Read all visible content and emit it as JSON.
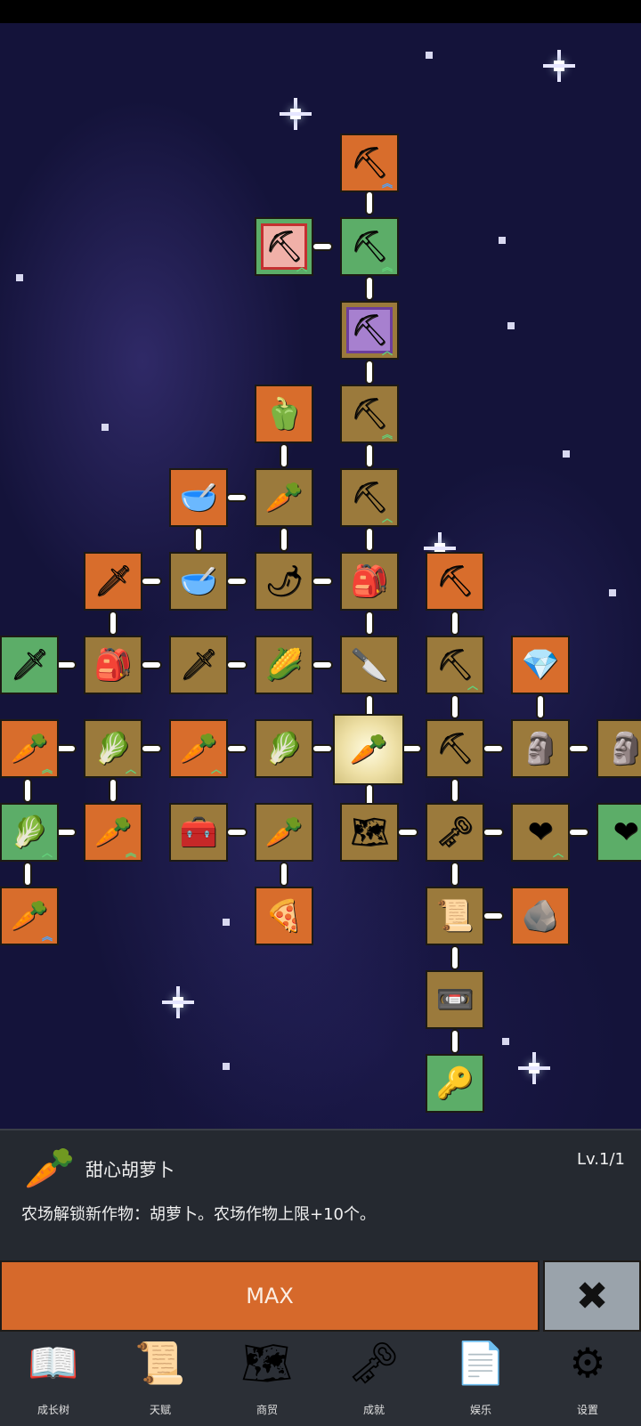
{
  "skill_tree": {
    "nodes": [
      {
        "id": "shovel-top",
        "icon": "shovel-icon",
        "glyph": "⛏",
        "color": "orange",
        "up": "︽",
        "up_color": "blue"
      },
      {
        "id": "shovel-red",
        "icon": "shovel-icon",
        "glyph": "⛏",
        "color": "green",
        "frame": "red",
        "up": "︿"
      },
      {
        "id": "shovel-2",
        "icon": "shovel-icon",
        "glyph": "⛏",
        "color": "green",
        "up": "︽"
      },
      {
        "id": "shovel-purple",
        "icon": "shovel-icon",
        "glyph": "⛏",
        "color": "tan",
        "frame": "purple",
        "up": "︿"
      },
      {
        "id": "pepper",
        "icon": "bell-pepper-icon",
        "glyph": "🫑",
        "color": "orange"
      },
      {
        "id": "shovel-3",
        "icon": "shovel-icon",
        "glyph": "⛏",
        "color": "tan",
        "up": "︽"
      },
      {
        "id": "bowl-1",
        "icon": "bowl-icon",
        "glyph": "🥣",
        "color": "orange"
      },
      {
        "id": "radish",
        "icon": "radish-icon",
        "glyph": "🥕",
        "color": "tan"
      },
      {
        "id": "shovel-4",
        "icon": "shovel-icon",
        "glyph": "⛏",
        "color": "tan",
        "up": "︿"
      },
      {
        "id": "sword-gold",
        "icon": "sword-icon",
        "glyph": "🗡",
        "color": "orange"
      },
      {
        "id": "bowl-2",
        "icon": "bowl-icon",
        "glyph": "🥣",
        "color": "tan"
      },
      {
        "id": "chili",
        "icon": "chili-icon",
        "glyph": "🌶",
        "color": "tan"
      },
      {
        "id": "backpack-1",
        "icon": "backpack-icon",
        "glyph": "🎒",
        "color": "tan"
      },
      {
        "id": "pickaxe-1",
        "icon": "pickaxe-icon",
        "glyph": "⛏",
        "color": "orange"
      },
      {
        "id": "sword-green",
        "icon": "sword-icon",
        "glyph": "🗡",
        "color": "green"
      },
      {
        "id": "backpack-2",
        "icon": "backpack-icon",
        "glyph": "🎒",
        "color": "tan"
      },
      {
        "id": "sword-2",
        "icon": "sword-icon",
        "glyph": "🗡",
        "color": "tan"
      },
      {
        "id": "corn",
        "icon": "corn-icon",
        "glyph": "🌽",
        "color": "tan"
      },
      {
        "id": "dagger",
        "icon": "dagger-icon",
        "glyph": "🔪",
        "color": "tan"
      },
      {
        "id": "pickaxe-2",
        "icon": "pickaxe-icon",
        "glyph": "⛏",
        "color": "tan",
        "up": "︿"
      },
      {
        "id": "crystal",
        "icon": "crystal-icon",
        "glyph": "💎",
        "color": "orange"
      },
      {
        "id": "carrot-1",
        "icon": "carrot-icon",
        "glyph": "🥕",
        "color": "orange",
        "up": "︽"
      },
      {
        "id": "cabbage-1",
        "icon": "cabbage-icon",
        "glyph": "🥬",
        "color": "tan",
        "up": "︿"
      },
      {
        "id": "carrot-2",
        "icon": "carrot-icon",
        "glyph": "🥕",
        "color": "orange",
        "up": "︿"
      },
      {
        "id": "cabbage-2",
        "icon": "cabbage-icon",
        "glyph": "🥬",
        "color": "tan"
      },
      {
        "id": "carrot-center",
        "icon": "carrot-icon",
        "glyph": "🥕",
        "color": "center"
      },
      {
        "id": "pickaxe-3",
        "icon": "pickaxe-icon",
        "glyph": "⛏",
        "color": "tan"
      },
      {
        "id": "statue-1",
        "icon": "statue-icon",
        "glyph": "🗿",
        "color": "tan"
      },
      {
        "id": "statue-2",
        "icon": "statue-icon",
        "glyph": "🗿",
        "color": "tan"
      },
      {
        "id": "cabbage-3",
        "icon": "cabbage-icon",
        "glyph": "🥬",
        "color": "green",
        "up": "︿"
      },
      {
        "id": "carrot-3",
        "icon": "carrot-icon",
        "glyph": "🥕",
        "color": "orange",
        "up": "︽"
      },
      {
        "id": "chest",
        "icon": "treasure-chest-icon",
        "glyph": "🧰",
        "color": "tan"
      },
      {
        "id": "parsnip",
        "icon": "parsnip-icon",
        "glyph": "🥕",
        "color": "tan"
      },
      {
        "id": "map",
        "icon": "map-icon",
        "glyph": "🗺",
        "color": "tan"
      },
      {
        "id": "key-gold",
        "icon": "key-icon",
        "glyph": "🗝",
        "color": "tan"
      },
      {
        "id": "heart-1",
        "icon": "heart-icon",
        "glyph": "❤",
        "color": "tan",
        "up": "︿"
      },
      {
        "id": "heart-2",
        "icon": "heart-icon",
        "glyph": "❤",
        "color": "green"
      },
      {
        "id": "carrot-4",
        "icon": "carrot-icon",
        "glyph": "🥕",
        "color": "orange",
        "up": "︽",
        "up_color": "blue"
      },
      {
        "id": "pizza",
        "icon": "pizza-icon",
        "glyph": "🍕",
        "color": "orange"
      },
      {
        "id": "scroll",
        "icon": "scroll-icon",
        "glyph": "📜",
        "color": "tan"
      },
      {
        "id": "ore",
        "icon": "ore-icon",
        "glyph": "🪨",
        "color": "orange"
      },
      {
        "id": "cassette",
        "icon": "cassette-icon",
        "glyph": "📼",
        "color": "tan"
      },
      {
        "id": "key-grey",
        "icon": "key-icon",
        "glyph": "🔑",
        "color": "green"
      }
    ]
  },
  "detail": {
    "icon": "carrot-icon",
    "glyph": "🥕",
    "title": "甜心胡萝卜",
    "level": "Lv.1/1",
    "description": "农场解锁新作物：胡萝卜。农场作物上限+10个。"
  },
  "actions": {
    "max_label": "MAX",
    "close_glyph": "✖"
  },
  "nav": {
    "items": [
      {
        "label": "成长树",
        "icon": "book-icon",
        "glyph": "📖"
      },
      {
        "label": "天赋",
        "icon": "scroll-icon",
        "glyph": "📜"
      },
      {
        "label": "商贸",
        "icon": "map-icon",
        "glyph": "🗺"
      },
      {
        "label": "成就",
        "icon": "key-icon",
        "glyph": "🗝"
      },
      {
        "label": "娱乐",
        "icon": "paper-icon",
        "glyph": "📄"
      },
      {
        "label": "设置",
        "icon": "gear-icon",
        "glyph": "⚙"
      }
    ]
  }
}
